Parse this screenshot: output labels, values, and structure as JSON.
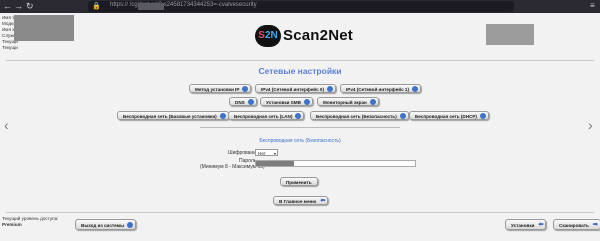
{
  "browser": {
    "back_icon": "back-arrow-icon",
    "forward_icon": "forward-arrow-icon",
    "reload_icon": "reload-icon",
    "url": "https://                  /cgi/net.cgi?-s24581734344253=-cvalvesecurity",
    "lock_icon": "lock-icon",
    "menu_icon": "hamburger-menu-icon"
  },
  "header": {
    "info_lines": [
      "Имя Ус",
      "Модель",
      "Имя хо",
      "Служеб",
      "Текущи",
      "Текущи"
    ],
    "logo_mark_a": "S",
    "logo_mark_b": "2N",
    "logo_word": "Scan2Net"
  },
  "main": {
    "title": "Сетевые настройки",
    "row1": [
      "Метод установки IP",
      "IPv4 (Сетевой интерфейс 0)",
      "IPv4 (Сетевой интерфейс 1)"
    ],
    "row2": [
      "DNS",
      "Установки SMB",
      "Мониторный экран"
    ],
    "row3": [
      "Беспроводная сеть (Базовые установки)",
      "Беспроводная сеть (LAN)",
      "Беспроводная сеть (Безопасность)",
      "Беспроводная сеть (DHCP)"
    ],
    "section_title": "Беспроводная сеть (Безопасность)",
    "encryption_label": "Шифрование",
    "encryption_value": "Нет",
    "password_label": "Пароль",
    "password_hint": "(Минимум 8 - Максимум 63)",
    "apply_label": "Применить",
    "home_label": "В Главное меню"
  },
  "footer": {
    "access_label": "Текущий уровень доступа:",
    "access_value": "Premium",
    "logout_label": "Выход из системы",
    "settings_label": "Установки",
    "scan_label": "Сканировать"
  },
  "accent_color": "#5b7fd6"
}
